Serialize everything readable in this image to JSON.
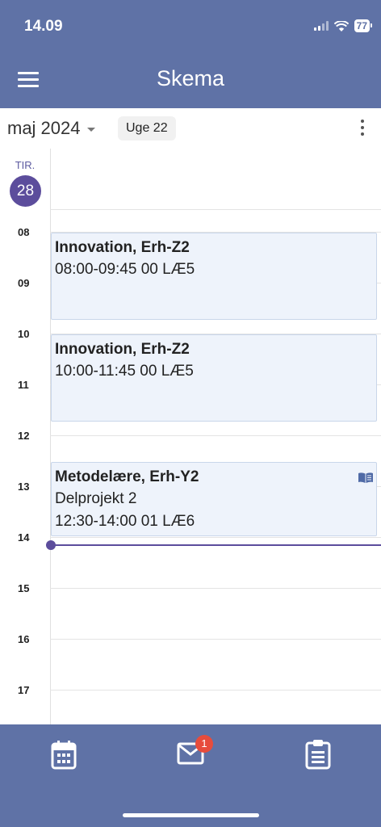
{
  "status": {
    "time": "14.09",
    "battery": "77"
  },
  "header": {
    "title": "Skema"
  },
  "toolbar": {
    "month": "maj 2024",
    "week": "Uge 22"
  },
  "day": {
    "weekday": "TIR.",
    "number": "28"
  },
  "hours": [
    "08",
    "09",
    "10",
    "11",
    "12",
    "13",
    "14",
    "15",
    "16",
    "17"
  ],
  "events": [
    {
      "title": "Innovation, Erh-Z2",
      "line1": "08:00-09:45 00 LÆ5"
    },
    {
      "title": "Innovation, Erh-Z2",
      "line1": "10:00-11:45 00 LÆ5"
    },
    {
      "title": "Metodelære, Erh-Y2",
      "line1": "Delprojekt 2",
      "line2": "12:30-14:00 01 LÆ6"
    }
  ],
  "nav": {
    "items": [
      {
        "icon": "calendar-icon"
      },
      {
        "icon": "mail-icon",
        "badge": "1"
      },
      {
        "icon": "clipboard-icon"
      }
    ]
  },
  "colors": {
    "header": "#5f72a6",
    "accent": "#5c4d9c",
    "event_bg": "#eef3fb",
    "badge": "#e74c3c"
  }
}
